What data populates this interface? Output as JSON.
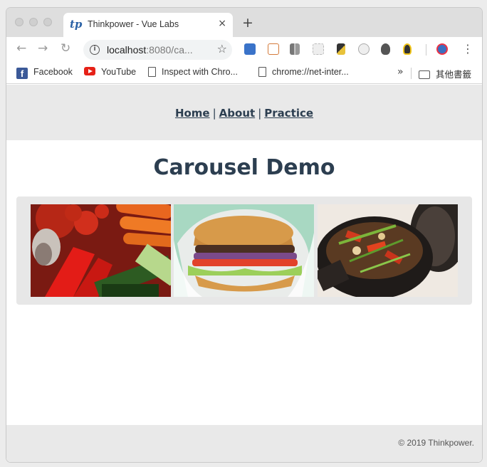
{
  "browser": {
    "tab": {
      "logo": "tp",
      "title": "Thinkpower - Vue Labs",
      "close_icon": "×"
    },
    "new_tab_icon": "+",
    "toolbar": {
      "back_icon": "←",
      "forward_icon": "→",
      "reload_icon": "↻",
      "info_icon": "i",
      "url_host": "localhost",
      "url_rest": ":8080/ca...",
      "star_icon": "☆",
      "menu_icon": "⋮"
    },
    "bookmarks": {
      "items": [
        {
          "label": "Facebook",
          "icon": "facebook-icon"
        },
        {
          "label": "YouTube",
          "icon": "youtube-icon"
        },
        {
          "label": "Inspect with Chro...",
          "icon": "page-icon"
        },
        {
          "label": "chrome://net-inter...",
          "icon": "page-icon"
        }
      ],
      "more_icon": "»",
      "other_folder": "其他書籤"
    }
  },
  "site": {
    "nav": {
      "home": "Home",
      "separator": "|",
      "about": "About",
      "practice": "Practice"
    },
    "title": "Carousel Demo",
    "carousel": {
      "slides": [
        {
          "name": "vegetables"
        },
        {
          "name": "burger"
        },
        {
          "name": "stew-pot"
        }
      ]
    },
    "footer": {
      "copyright": "© 2019 Thinkpower."
    }
  },
  "colors": {
    "text_primary": "#2c3e50",
    "chrome_bg": "#dedede",
    "section_bg": "#e9e9e9"
  }
}
